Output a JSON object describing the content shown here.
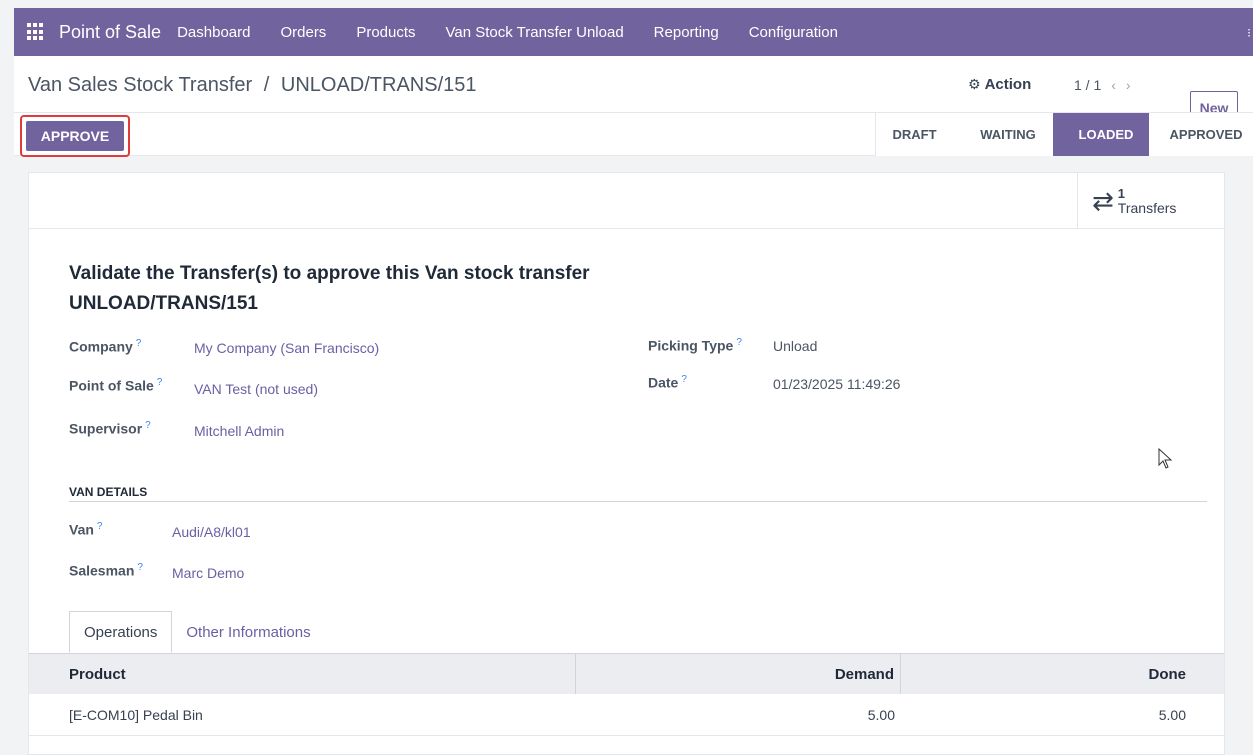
{
  "navbar": {
    "brand": "Point of Sale",
    "items": [
      "Dashboard",
      "Orders",
      "Products",
      "Van Stock Transfer Unload",
      "Reporting",
      "Configuration"
    ],
    "accent": "#71639e"
  },
  "control": {
    "breadcrumb_parent": "Van Sales Stock Transfer",
    "breadcrumb_sep": "/",
    "breadcrumb_current": "UNLOAD/TRANS/151",
    "action_label": "Action",
    "pager": "1 / 1",
    "new_label": "New",
    "approve_label": "APPROVE",
    "stages": [
      "DRAFT",
      "WAITING",
      "LOADED",
      "APPROVED"
    ],
    "current_stage": "LOADED"
  },
  "smart_button": {
    "count": "1",
    "label": "Transfers"
  },
  "form": {
    "title": "Validate the Transfer(s) to approve this Van stock transfer UNLOAD/TRANS/151",
    "fields": {
      "company": {
        "label": "Company",
        "value": "My Company (San Francisco)"
      },
      "point_of_sale": {
        "label": "Point of Sale",
        "value": "VAN Test (not used)"
      },
      "supervisor": {
        "label": "Supervisor",
        "value": "Mitchell Admin"
      },
      "picking_type": {
        "label": "Picking Type",
        "value": "Unload"
      },
      "date": {
        "label": "Date",
        "value": "01/23/2025 11:49:26"
      }
    },
    "help_mark": "?",
    "van_section": {
      "title": "VAN DETAILS",
      "van": {
        "label": "Van",
        "value": "Audi/A8/kl01"
      },
      "salesman": {
        "label": "Salesman",
        "value": "Marc Demo"
      }
    }
  },
  "tabs": [
    "Operations",
    "Other Informations"
  ],
  "table": {
    "headers": {
      "product": "Product",
      "demand": "Demand",
      "done": "Done"
    },
    "rows": [
      {
        "product": "[E-COM10] Pedal Bin",
        "demand": "5.00",
        "done": "5.00"
      }
    ]
  }
}
